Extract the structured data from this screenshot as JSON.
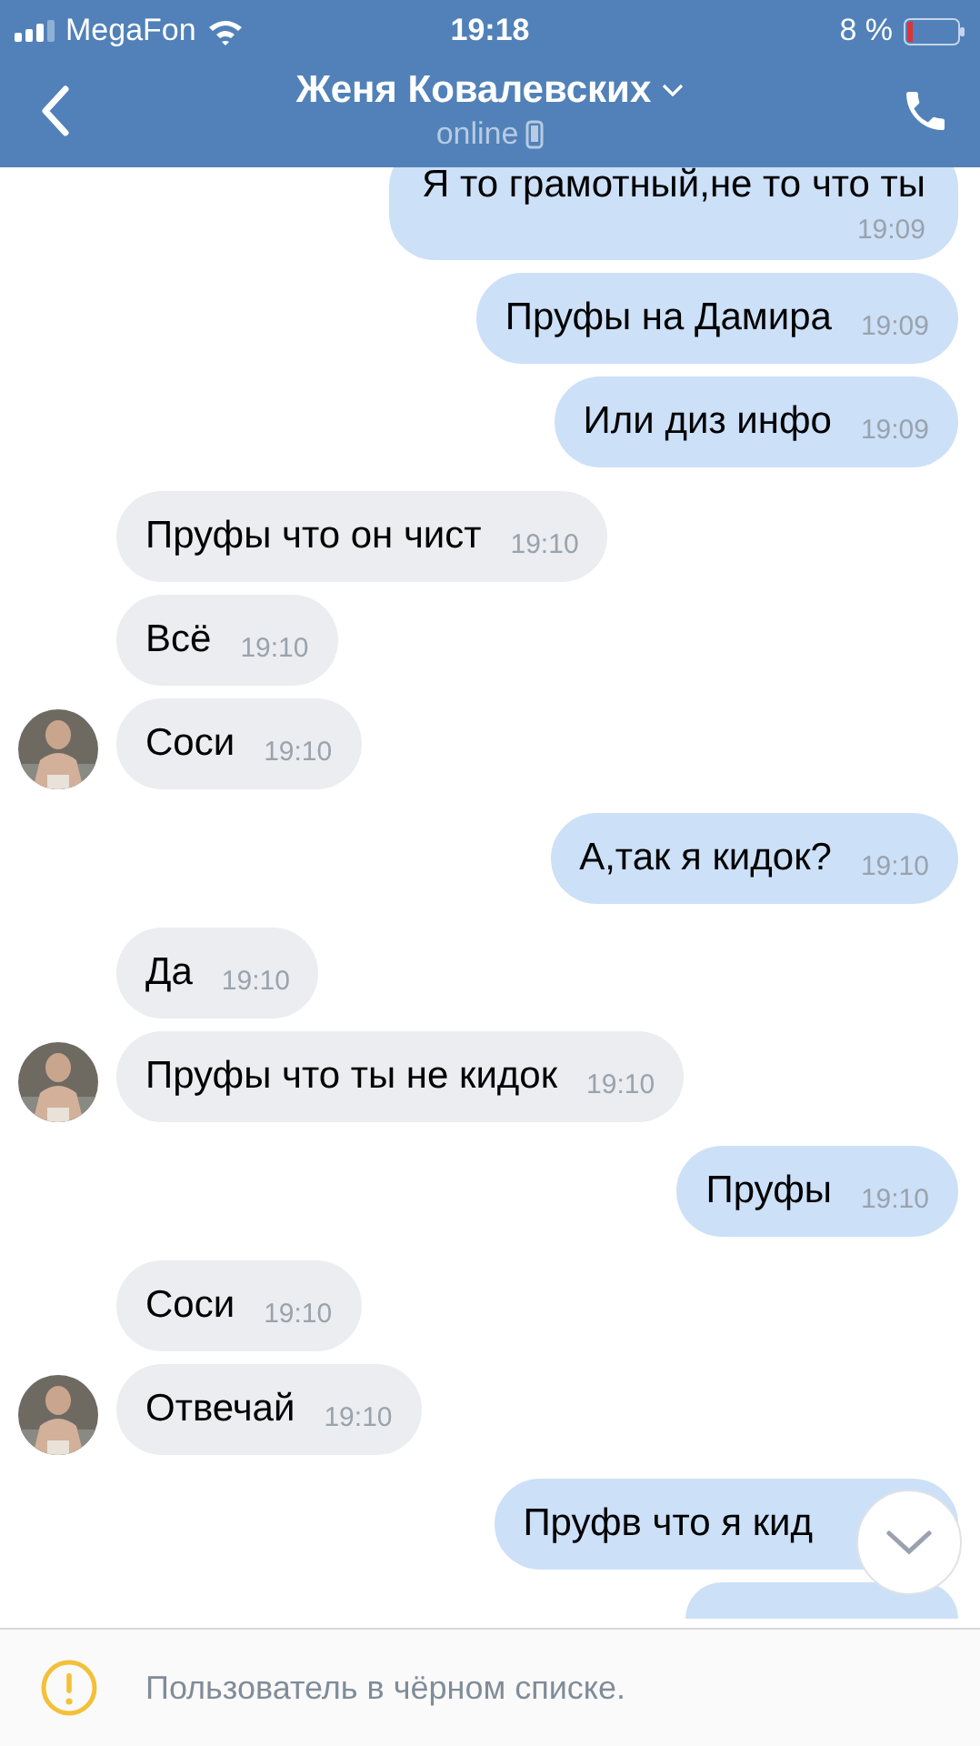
{
  "status_bar": {
    "carrier": "MegaFon",
    "time": "19:18",
    "battery": "8 %"
  },
  "header": {
    "title": "Женя Ковалевских",
    "subtitle": "online"
  },
  "messages": [
    {
      "kind": "out_long",
      "text": "Я то грамотный,не то что ты",
      "time": "19:09"
    },
    {
      "kind": "out",
      "text": "Пруфы на Дамира",
      "time": "19:09"
    },
    {
      "kind": "out",
      "text": "Или диз инфо",
      "time": "19:09"
    },
    {
      "kind": "in",
      "text": "Пруфы что он чист",
      "time": "19:10",
      "avatar": false
    },
    {
      "kind": "in",
      "text": "Всё",
      "time": "19:10",
      "avatar": false
    },
    {
      "kind": "in",
      "text": "Соси",
      "time": "19:10",
      "avatar": true
    },
    {
      "kind": "out",
      "text": "А,так я кидок?",
      "time": "19:10"
    },
    {
      "kind": "in",
      "text": "Да",
      "time": "19:10",
      "avatar": false
    },
    {
      "kind": "in",
      "text": "Пруфы что ты не кидок",
      "time": "19:10",
      "avatar": true
    },
    {
      "kind": "out",
      "text": "Пруфы",
      "time": "19:10"
    },
    {
      "kind": "in",
      "text": "Соси",
      "time": "19:10",
      "avatar": false
    },
    {
      "kind": "in",
      "text": "Отвечай",
      "time": "19:10",
      "avatar": true
    },
    {
      "kind": "out",
      "text": "Пруфв что я кид"
    },
    {
      "kind": "out_cut"
    }
  ],
  "notice": {
    "text": "Пользователь в чёрном списке."
  }
}
